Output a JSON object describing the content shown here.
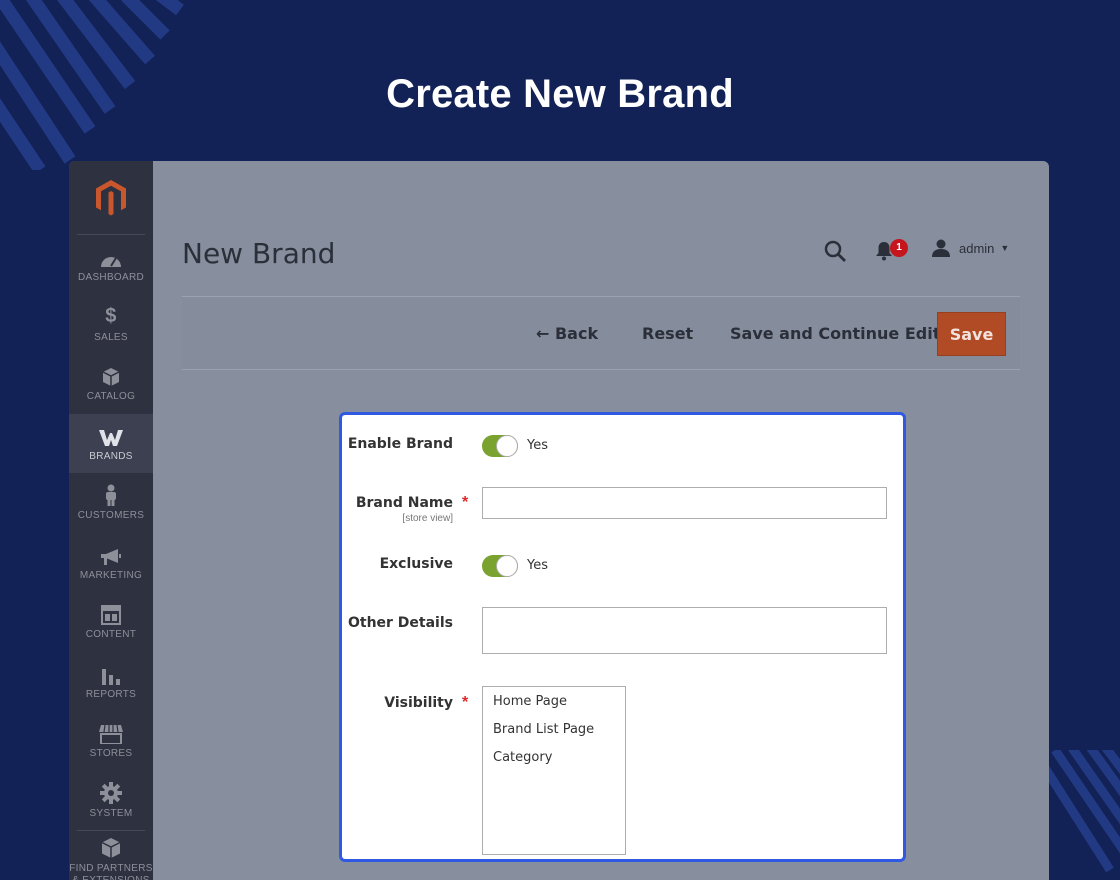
{
  "promo": {
    "title": "Create New Brand"
  },
  "sidebar": {
    "items": [
      {
        "label": "DASHBOARD",
        "icon": "dashboard-icon"
      },
      {
        "label": "SALES",
        "icon": "dollar-icon"
      },
      {
        "label": "CATALOG",
        "icon": "box-icon"
      },
      {
        "label": "BRANDS",
        "icon": "brands-icon",
        "active": true
      },
      {
        "label": "CUSTOMERS",
        "icon": "person-icon"
      },
      {
        "label": "MARKETING",
        "icon": "megaphone-icon"
      },
      {
        "label": "CONTENT",
        "icon": "layout-icon"
      },
      {
        "label": "REPORTS",
        "icon": "bar-chart-icon"
      },
      {
        "label": "STORES",
        "icon": "storefront-icon"
      },
      {
        "label": "SYSTEM",
        "icon": "gear-icon"
      }
    ],
    "partners_label": "FIND PARTNERS & EXTENSIONS"
  },
  "header": {
    "page_title": "New Brand",
    "notification_count": "1",
    "username": "admin"
  },
  "actionbar": {
    "back_label": "Back",
    "reset_label": "Reset",
    "save_continue_label": "Save and Continue Edit",
    "save_label": "Save"
  },
  "form": {
    "enable_brand": {
      "label": "Enable Brand",
      "value": "Yes"
    },
    "brand_name": {
      "label": "Brand Name",
      "scope": "[store view]",
      "value": ""
    },
    "exclusive": {
      "label": "Exclusive",
      "value": "Yes"
    },
    "other_details": {
      "label": "Other Details",
      "value": ""
    },
    "visibility": {
      "label": "Visibility",
      "options": [
        "Home Page",
        "Brand List Page",
        "Category"
      ]
    },
    "required_mark": "*"
  },
  "colors": {
    "background": "#132256",
    "accent_border": "#2f59e3",
    "save_button": "#b14b26",
    "toggle_on": "#79a22e",
    "badge": "#c5161d"
  }
}
